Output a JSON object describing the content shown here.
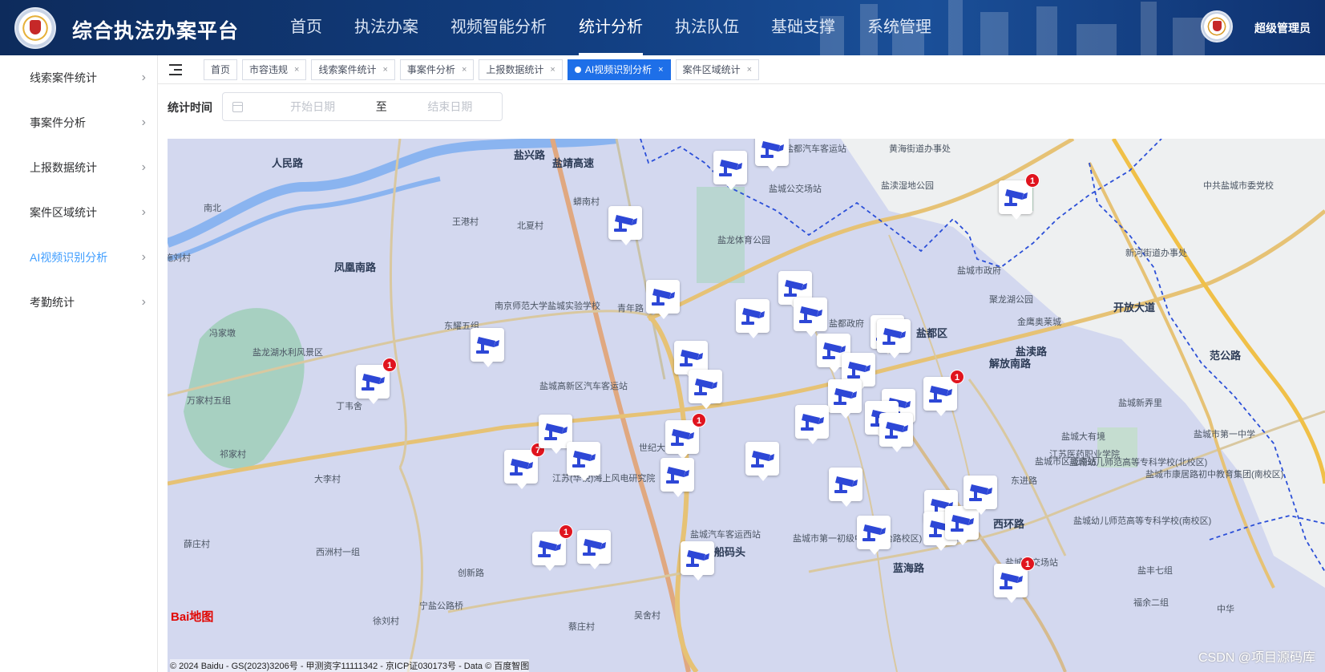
{
  "header": {
    "title": "综合执法办案平台",
    "nav": [
      "首页",
      "执法办案",
      "视频智能分析",
      "统计分析",
      "执法队伍",
      "基础支撑",
      "系统管理"
    ],
    "active_nav": 3,
    "user": "超级管理员"
  },
  "sidebar": {
    "items": [
      {
        "label": "线索案件统计",
        "active": false
      },
      {
        "label": "事案件分析",
        "active": false
      },
      {
        "label": "上报数据统计",
        "active": false
      },
      {
        "label": "案件区域统计",
        "active": false
      },
      {
        "label": "AI视频识别分析",
        "active": true
      },
      {
        "label": "考勤统计",
        "active": false
      }
    ]
  },
  "tabs": [
    {
      "label": "首页",
      "closable": false,
      "active": false
    },
    {
      "label": "市容违规",
      "closable": true,
      "active": false
    },
    {
      "label": "线索案件统计",
      "closable": true,
      "active": false
    },
    {
      "label": "事案件分析",
      "closable": true,
      "active": false
    },
    {
      "label": "上报数据统计",
      "closable": true,
      "active": false
    },
    {
      "label": "AI视频识别分析",
      "closable": true,
      "active": true
    },
    {
      "label": "案件区域统计",
      "closable": true,
      "active": false
    }
  ],
  "filter": {
    "label": "统计时间",
    "start_placeholder": "开始日期",
    "separator": "至",
    "end_placeholder": "结束日期"
  },
  "map": {
    "labels": [
      "盐兴路",
      "人民路",
      "凤凰南路",
      "盐靖高速",
      "王港村",
      "北夏村",
      "蟒南村",
      "东耀五组",
      "盐龙湖水利风景区",
      "冯家墩",
      "施刘村",
      "南北",
      "万家村五组",
      "丁韦舍",
      "祁家村",
      "大李村",
      "薛庄村",
      "西洲村一组",
      "创新路",
      "宁盐公路桥",
      "徐刘村",
      "蔡庄村",
      "吴舍村",
      "南京师范大学盐城实验学校",
      "盐城高新区汽车客运站",
      "江苏(华锐)海上风电研究院",
      "青年路",
      "世纪大道",
      "盐城汽车客运西站",
      "盐龙体育公园",
      "盐都汽车客运站",
      "盐城公交场站",
      "盐渎湿地公园",
      "黄海街道办事处",
      "盐都政府",
      "盐都区",
      "盐城市政府",
      "聚龙湖公园",
      "金鹰奥莱城",
      "新河街道办事处",
      "中共盐城市委党校",
      "开放大道",
      "范公路",
      "解放南路",
      "西环路",
      "盐渎路",
      "蓝海路",
      "船码头",
      "东进路",
      "江苏医药职业学院",
      "盐城新弄里",
      "盐城大有境",
      "盐城幼儿师范高等专科学校(北校区)",
      "盐城幼儿师范高等专科学校(南校区)",
      "盐城市第一初级中学(吴抬路校区)",
      "盐城市区城南站",
      "盐城市康居路初中教育集团(南校区)",
      "盐城市第一中学",
      "盐城公交场站",
      "盐丰七组",
      "福余二组",
      "中华"
    ],
    "baidu_logo": "Bai地图",
    "copyright": "© 2024 Baidu - GS(2023)3206号 - 甲测资字11111342 - 京ICP证030173号 - Data © 百度智图",
    "watermark": "CSDN @项目源码库",
    "camera_icon": "cctv-camera-icon",
    "markers": [
      {
        "count": null
      },
      {
        "count": null
      },
      {
        "count": 1
      },
      {
        "count": null
      },
      {
        "count": 1
      },
      {
        "count": null
      },
      {
        "count": null
      },
      {
        "count": null
      },
      {
        "count": null
      },
      {
        "count": null
      },
      {
        "count": null
      },
      {
        "count": null
      },
      {
        "count": null
      },
      {
        "count": null
      },
      {
        "count": null
      },
      {
        "count": null
      },
      {
        "count": null
      },
      {
        "count": 1
      },
      {
        "count": null
      },
      {
        "count": 7
      },
      {
        "count": null
      },
      {
        "count": null
      },
      {
        "count": 1
      },
      {
        "count": null
      },
      {
        "count": null
      },
      {
        "count": null
      },
      {
        "count": null
      },
      {
        "count": null
      },
      {
        "count": null
      },
      {
        "count": null
      },
      {
        "count": null
      },
      {
        "count": null
      },
      {
        "count": null
      },
      {
        "count": 1
      },
      {
        "count": null
      },
      {
        "count": null
      },
      {
        "count": 1
      },
      {
        "count": null
      }
    ]
  },
  "colors": {
    "header_bg": "#123f82",
    "accent": "#1e6fe8",
    "sidebar_active": "#409eff",
    "badge": "#e0141e",
    "camera": "#2d47d6"
  }
}
